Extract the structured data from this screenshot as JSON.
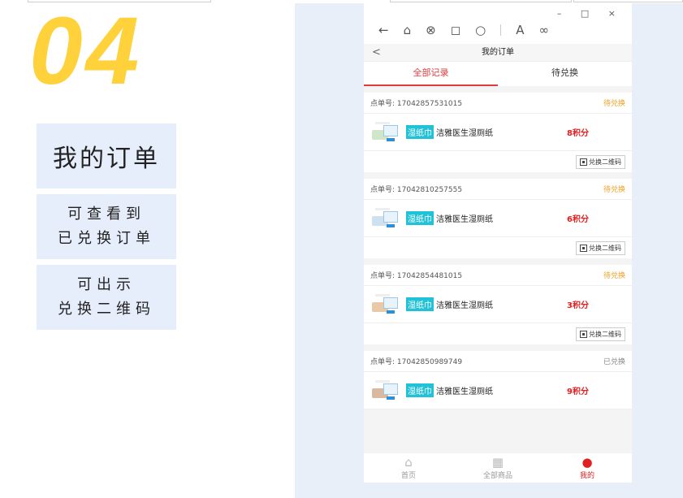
{
  "promo": {
    "number": "04",
    "title": "我的订单",
    "feature_a_line1": "可查看到",
    "feature_a_line2": "已兑换订单",
    "feature_b_line1": "可出示",
    "feature_b_line2": "兑换二维码"
  },
  "browser": {
    "controls": [
      "–",
      "□",
      "×"
    ],
    "tools": [
      "←",
      "⌂",
      "⊗",
      "◻",
      "○",
      "A",
      "∞"
    ]
  },
  "nav": {
    "back": "<",
    "title": "我的订单"
  },
  "tabs": [
    {
      "label": "全部记录",
      "active": true
    },
    {
      "label": "待兑换",
      "active": false
    }
  ],
  "order_prefix": "点单号: ",
  "orders": [
    {
      "id": "17042857531015",
      "status": "待兑换",
      "tag": "湿纸巾",
      "name": "洁雅医生湿厕纸",
      "points": "8积分",
      "button": "兑换二维码"
    },
    {
      "id": "17042810257555",
      "status": "待兑换",
      "tag": "湿纸巾",
      "name": "洁雅医生湿厕纸",
      "points": "6积分",
      "button": "兑换二维码"
    },
    {
      "id": "17042854481015",
      "status": "待兑换",
      "tag": "湿纸巾",
      "name": "洁雅医生湿厕纸",
      "points": "3积分",
      "button": "兑换二维码"
    },
    {
      "id": "17042850989749",
      "status": "已兑换",
      "tag": "湿纸巾",
      "name": "洁雅医生湿厕纸",
      "points": "9积分",
      "button": ""
    }
  ],
  "tabbar": [
    {
      "label": "首页",
      "icon": "home-icon",
      "active": false
    },
    {
      "label": "全部商品",
      "icon": "grid-icon",
      "active": false
    },
    {
      "label": "我的",
      "icon": "user-icon",
      "active": true
    }
  ],
  "colors": {
    "accent": "#e02020",
    "pending": "#f0a020",
    "promo_yellow": "#ffd23c",
    "panel_bg": "#e8eff9"
  }
}
